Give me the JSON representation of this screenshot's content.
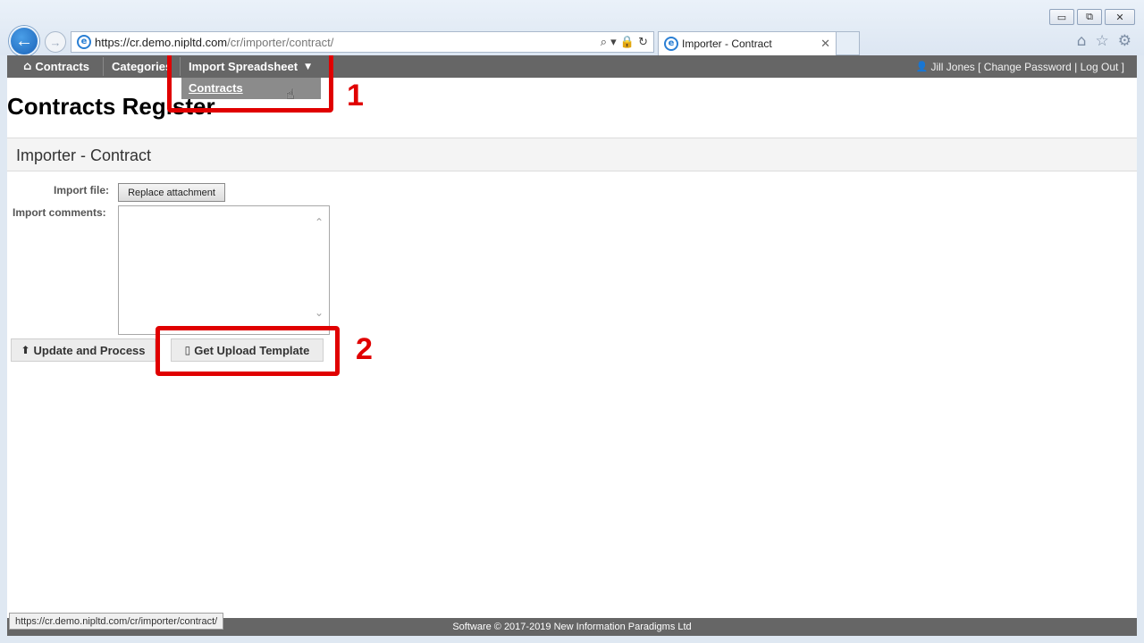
{
  "window": {
    "minimize": "▭",
    "restore": "⧉",
    "close": "✕"
  },
  "addressbar": {
    "url_prefix": "https://cr.demo.",
    "url_domain": "nipltd.com",
    "url_path": "/cr/importer/contract/",
    "tools": "⌕ ▾ 🔒 ↻"
  },
  "tab": {
    "title": "Importer - Contract",
    "close": "✕"
  },
  "toolbar_icons": {
    "home": "⌂",
    "favorites": "☆",
    "settings": "⚙"
  },
  "navbar": {
    "items": [
      {
        "label": "Contracts"
      },
      {
        "label": "Categories"
      },
      {
        "label": "Import Spreadsheet"
      }
    ],
    "user": "Jill Jones [ Change Password | Log Out ]"
  },
  "dropdown": {
    "items": [
      {
        "label": "Contracts"
      }
    ]
  },
  "page": {
    "title": "Contracts Register",
    "section_title": "Importer - Contract"
  },
  "form": {
    "import_file_label": "Import file:",
    "replace_attachment_label": "Replace attachment",
    "import_comments_label": "Import comments:",
    "import_comments_value": ""
  },
  "actions": {
    "update_process_label": "Update and Process",
    "get_template_label": "Get Upload Template"
  },
  "annotations": {
    "one": "1",
    "two": "2"
  },
  "status": {
    "link_preview": "https://cr.demo.nipltd.com/cr/importer/contract/"
  },
  "footer": {
    "text": "Software © 2017-2019 New Information Paradigms Ltd"
  },
  "colors": {
    "navbar": "#666666",
    "annotation": "#e00000",
    "dropdown": "#8b8b8b"
  }
}
